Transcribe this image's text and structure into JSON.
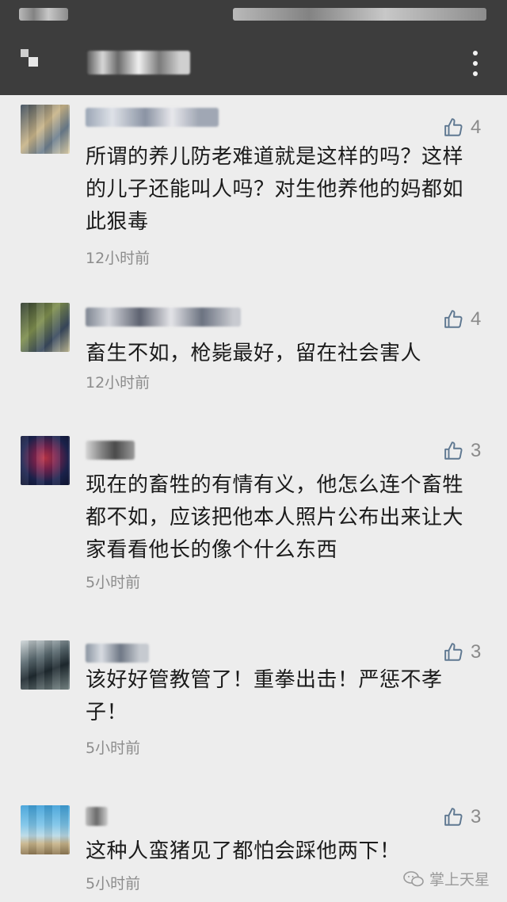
{
  "status_bar": {},
  "header": {
    "back_icon": "back-arrow-icon",
    "title": "•••••",
    "more_icon": "more-vertical-icon"
  },
  "comments": [
    {
      "username": "••••••",
      "likes": "4",
      "text": "所谓的养儿防老难道就是这样的吗？这样的儿子还能叫人吗？对生他养他的妈都如此狠毒",
      "time": "12小时前"
    },
    {
      "username": "••••••",
      "likes": "4",
      "text": "畜生不如，枪毙最好，留在社会害人",
      "time": "12小时前"
    },
    {
      "username": "•••",
      "likes": "3",
      "text": "现在的畜牲的有情有义，他怎么连个畜牲都不如，应该把他本人照片公布出来让大家看看他长的像个什么东西",
      "time": "5小时前"
    },
    {
      "username": "••••",
      "likes": "3",
      "text": "该好好管教管了！重拳出击！严惩不孝子！",
      "time": "5小时前"
    },
    {
      "username": "•",
      "likes": "3",
      "text": "这种人蛮猪见了都怕会踩他两下！",
      "time": "5小时前"
    }
  ],
  "watermark": {
    "icon": "wechat-icon",
    "text": "掌上天星"
  },
  "colors": {
    "header_bg": "#3d3d3d",
    "page_bg": "#ededed",
    "like_color": "#8a8a8a",
    "time_color": "#8c8c8c"
  }
}
